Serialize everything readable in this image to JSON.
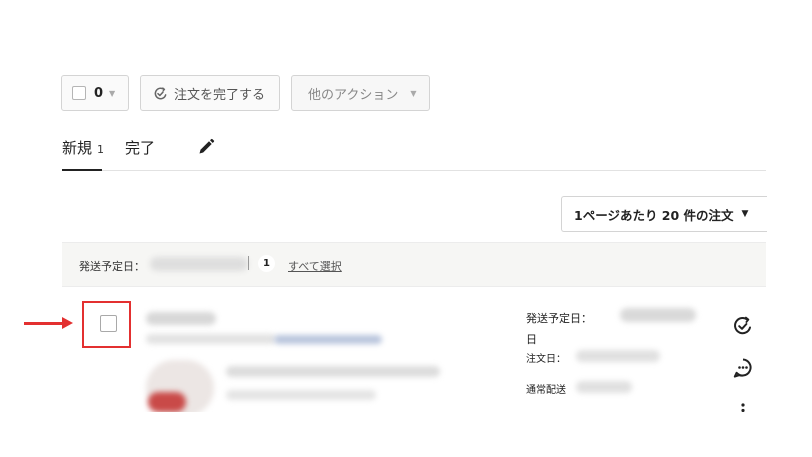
{
  "toolbar": {
    "select_count": "0",
    "complete_label": "注文を完了する",
    "other_actions_label": "他のアクション"
  },
  "tabs": [
    {
      "label": "新規",
      "count": "1"
    },
    {
      "label": "完了"
    }
  ],
  "per_page_label": "1ページあたり 20 件の注文",
  "group": {
    "ship_date_label": "発送予定日：",
    "count": "1",
    "select_all_label": "すべて選択"
  },
  "order": {
    "ship_date_label": "発送予定日：",
    "ship_date_suffix": "日",
    "order_date_label": "注文日：",
    "shipping_method": "通常配送"
  },
  "colors": {
    "annotation": "#e33030",
    "group_header_bg": "#f6f6f4",
    "link": "#555555"
  }
}
